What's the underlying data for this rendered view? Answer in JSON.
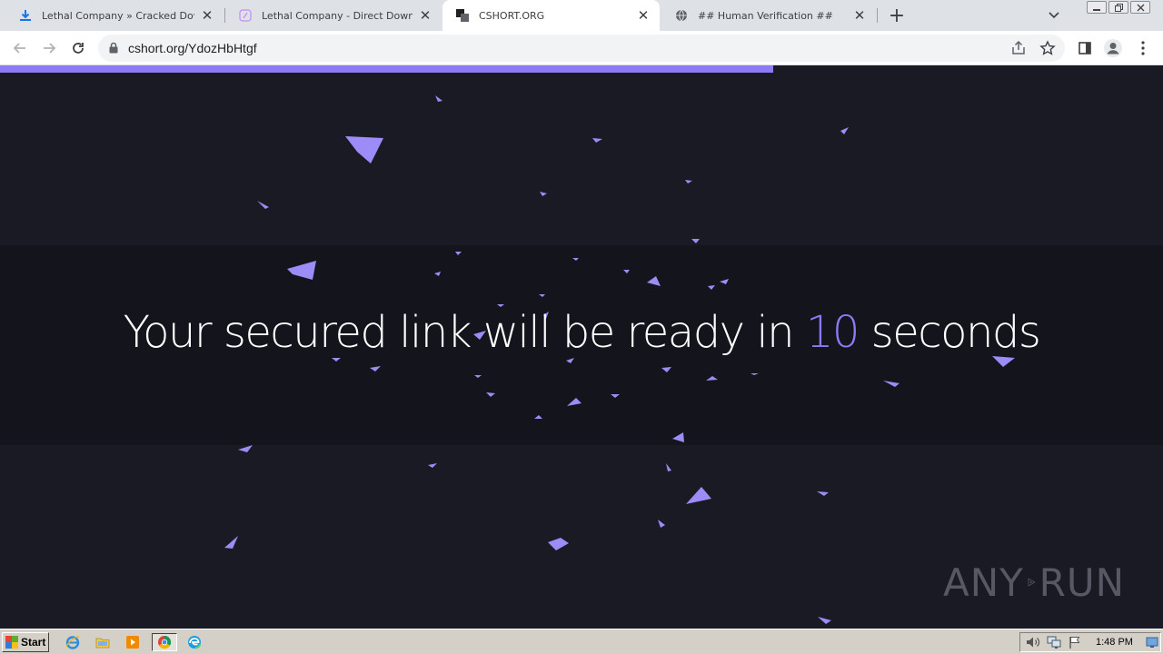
{
  "browser": {
    "tabs": [
      {
        "title": "Lethal Company » Cracked Download",
        "favicon": "download-icon",
        "active": false
      },
      {
        "title": "Lethal Company - Direct Download (F",
        "favicon": "page-icon",
        "active": false
      },
      {
        "title": "CSHORT.ORG",
        "favicon": "cshort-logo-icon",
        "active": true
      },
      {
        "title": "## Human Verification ##",
        "favicon": "globe-icon",
        "active": false
      }
    ],
    "address_bar": {
      "url": "cshort.org/YdozHbHtgf"
    }
  },
  "page": {
    "progress": 0.665,
    "message_prefix": "Your secured link will be ready in ",
    "countdown": "10",
    "message_suffix": " seconds",
    "accent_color": "#8b7cf6",
    "background_color": "#191a24"
  },
  "watermark": {
    "left": "ANY",
    "right": "RUN"
  },
  "taskbar": {
    "start_label": "Start",
    "quick_launch": [
      "ie-icon",
      "explorer-icon",
      "media-player-icon",
      "chrome-icon",
      "edge-icon"
    ],
    "tray_icons": [
      "volume-icon",
      "network-icon",
      "flag-icon"
    ],
    "clock": "1:48 PM"
  }
}
